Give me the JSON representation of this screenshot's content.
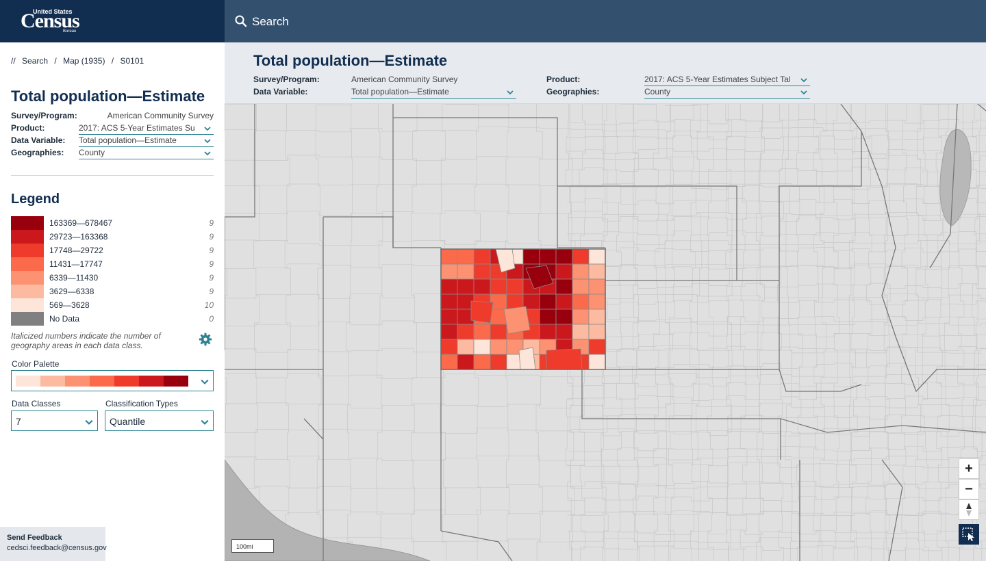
{
  "header": {
    "logo_line1": "United States",
    "logo_line2": "Census",
    "logo_line3": "Bureau",
    "search_label": "Search"
  },
  "breadcrumb": {
    "sep0": "//",
    "items": [
      "Search",
      "Map (1935)",
      "S0101"
    ],
    "sep": "/"
  },
  "left_panel": {
    "title": "Total population—Estimate",
    "fields": [
      {
        "key": "Survey/Program:",
        "value": "American Community Survey"
      },
      {
        "key": "Product:",
        "value": "2017: ACS 5-Year Estimates Su"
      },
      {
        "key": "Data Variable:",
        "value": "Total population—Estimate"
      },
      {
        "key": "Geographies:",
        "value": "County"
      }
    ],
    "legend_heading": "Legend",
    "legend": [
      {
        "label": "163369—678467",
        "count": "9",
        "color": "#99000d"
      },
      {
        "label": "29723—163368",
        "count": "9",
        "color": "#cb181d"
      },
      {
        "label": "17748—29722",
        "count": "9",
        "color": "#ef3b2c"
      },
      {
        "label": "11431—17747",
        "count": "9",
        "color": "#fb6a4a"
      },
      {
        "label": "6339—11430",
        "count": "9",
        "color": "#fc9272"
      },
      {
        "label": "3629—6338",
        "count": "9",
        "color": "#fcbba1"
      },
      {
        "label": "569—3628",
        "count": "10",
        "color": "#fee5d9"
      },
      {
        "label": "No Data",
        "count": "0",
        "color": "#808080"
      }
    ],
    "legend_note": "Italicized numbers indicate the number of geography areas in each data class.",
    "color_palette_label": "Color Palette",
    "palette": [
      "#fee5d9",
      "#fcbba1",
      "#fc9272",
      "#fb6a4a",
      "#ef3b2c",
      "#cb181d",
      "#99000d"
    ],
    "data_classes_label": "Data Classes",
    "data_classes_value": "7",
    "classification_label": "Classification Types",
    "classification_value": "Quantile"
  },
  "feedback": {
    "title": "Send Feedback",
    "email": "cedsci.feedback@census.gov"
  },
  "main_top": {
    "title": "Total population—Estimate",
    "survey_key": "Survey/Program:",
    "survey_value": "American Community Survey",
    "variable_key": "Data Variable:",
    "variable_value": "Total population—Estimate",
    "product_key": "Product:",
    "product_value": "2017: ACS 5-Year Estimates Subject Tal",
    "geo_key": "Geographies:",
    "geo_value": "County"
  },
  "map": {
    "zoom_in": "+",
    "zoom_out": "−",
    "scale_label": "100mi",
    "base_color": "#e0e0e0",
    "state_line_color": "#777777",
    "county_line_color": "#c8c8c8",
    "water_color": "#b3b3b3"
  }
}
